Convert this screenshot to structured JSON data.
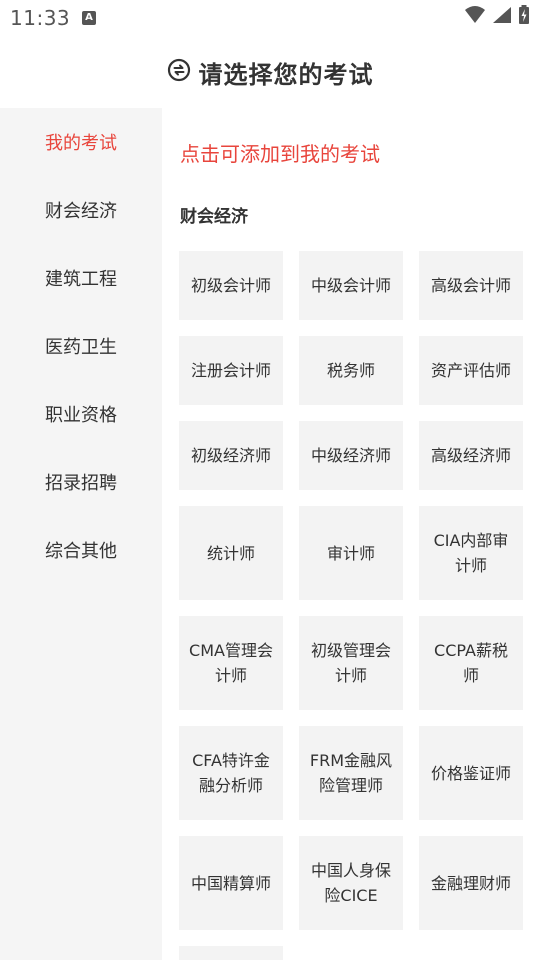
{
  "status_bar": {
    "time": "11:33",
    "notification_letter": "A"
  },
  "header": {
    "title": "请选择您的考试",
    "icon": "refresh-icon"
  },
  "sidebar": {
    "items": [
      {
        "label": "我的考试",
        "active": true
      },
      {
        "label": "财会经济",
        "active": false
      },
      {
        "label": "建筑工程",
        "active": false
      },
      {
        "label": "医药卫生",
        "active": false
      },
      {
        "label": "职业资格",
        "active": false
      },
      {
        "label": "招录招聘",
        "active": false
      },
      {
        "label": "综合其他",
        "active": false
      }
    ]
  },
  "main": {
    "hint": "点击可添加到我的考试",
    "section_title": "财会经济",
    "exams": [
      "初级会计师",
      "中级会计师",
      "高级会计师",
      "注册会计师",
      "税务师",
      "资产评估师",
      "初级经济师",
      "中级经济师",
      "高级经济师",
      "统计师",
      "审计师",
      "CIA内部审计师",
      "CMA管理会计师",
      "初级管理会计师",
      "CCPA薪税师",
      "CFA特许金融分析师",
      "FRM金融风险管理师",
      "价格鉴证师",
      "中国精算师",
      "中国人身保险CICE",
      "金融理财师"
    ]
  },
  "colors": {
    "accent": "#e8453c",
    "sidebar_bg": "#f5f5f5",
    "card_bg": "#f3f3f3",
    "text": "#333333"
  }
}
